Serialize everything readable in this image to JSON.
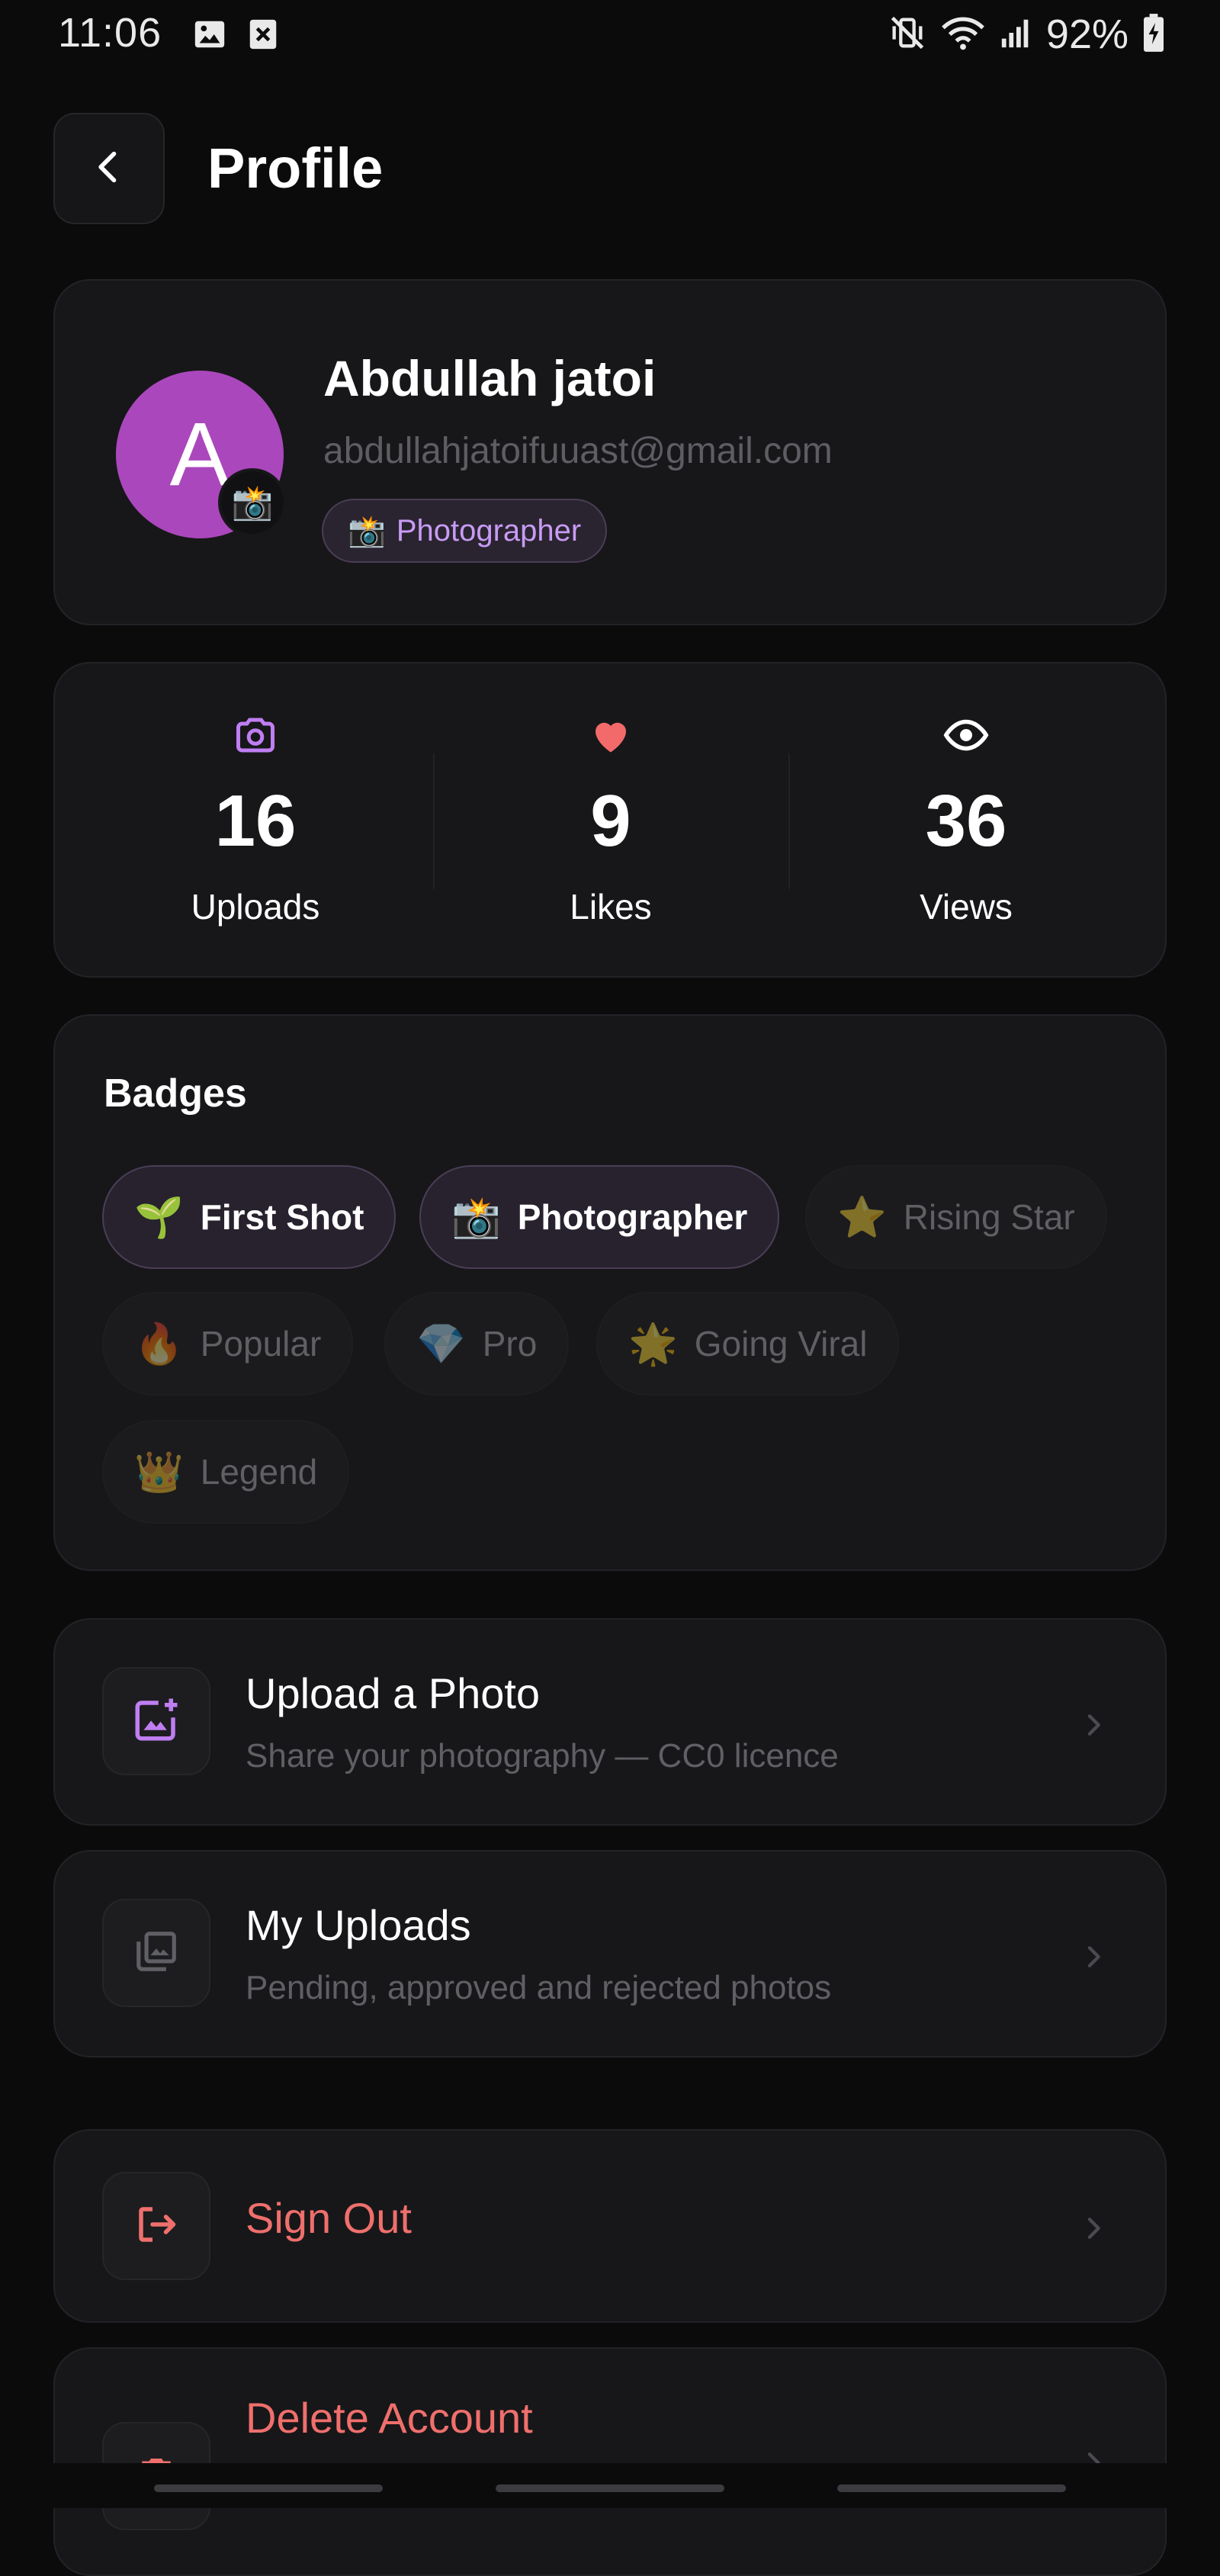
{
  "status_bar": {
    "time": "11:06",
    "battery": "92%",
    "left_icons": [
      "gallery-icon",
      "blocked-notification-icon"
    ],
    "right_icons": [
      "mute-vibrate-icon",
      "wifi-icon",
      "signal-icon",
      "battery-charging-icon"
    ]
  },
  "header": {
    "title": "Profile",
    "back_icon": "chevron-left-icon"
  },
  "profile": {
    "avatar_initial": "A",
    "avatar_color": "#ab47bc",
    "avatar_badge_emoji": "📸",
    "name": "Abdullah jatoi",
    "email": "abdullahjatoifuuast@gmail.com",
    "role_emoji": "📸",
    "role": "Photographer"
  },
  "stats": [
    {
      "icon": "camera-icon",
      "color": "#c07ef2",
      "value": "16",
      "label": "Uploads"
    },
    {
      "icon": "heart-icon",
      "color": "#f26a6a",
      "value": "9",
      "label": "Likes"
    },
    {
      "icon": "eye-icon",
      "color": "#ffffff",
      "value": "36",
      "label": "Views"
    }
  ],
  "badges": {
    "title": "Badges",
    "items": [
      {
        "emoji": "🌱",
        "label": "First Shot",
        "earned": true
      },
      {
        "emoji": "📸",
        "label": "Photographer",
        "earned": true
      },
      {
        "emoji": "⭐",
        "label": "Rising Star",
        "earned": false
      },
      {
        "emoji": "🔥",
        "label": "Popular",
        "earned": false
      },
      {
        "emoji": "💎",
        "label": "Pro",
        "earned": false
      },
      {
        "emoji": "🌟",
        "label": "Going Viral",
        "earned": false
      },
      {
        "emoji": "👑",
        "label": "Legend",
        "earned": false
      }
    ]
  },
  "menu": {
    "upload": {
      "title": "Upload a Photo",
      "subtitle": "Share your photography — CC0 licence",
      "icon": "add-photo-icon"
    },
    "my_uploads": {
      "title": "My Uploads",
      "subtitle": "Pending, approved and rejected photos",
      "icon": "photo-library-icon"
    },
    "sign_out": {
      "title": "Sign Out",
      "icon": "logout-icon"
    },
    "delete_account": {
      "title": "Delete Account",
      "icon": "delete-icon"
    }
  },
  "colors": {
    "accent_purple": "#c07ef2",
    "danger": "#ef6f6c",
    "background": "#0b0b0c",
    "card": "#171719"
  }
}
